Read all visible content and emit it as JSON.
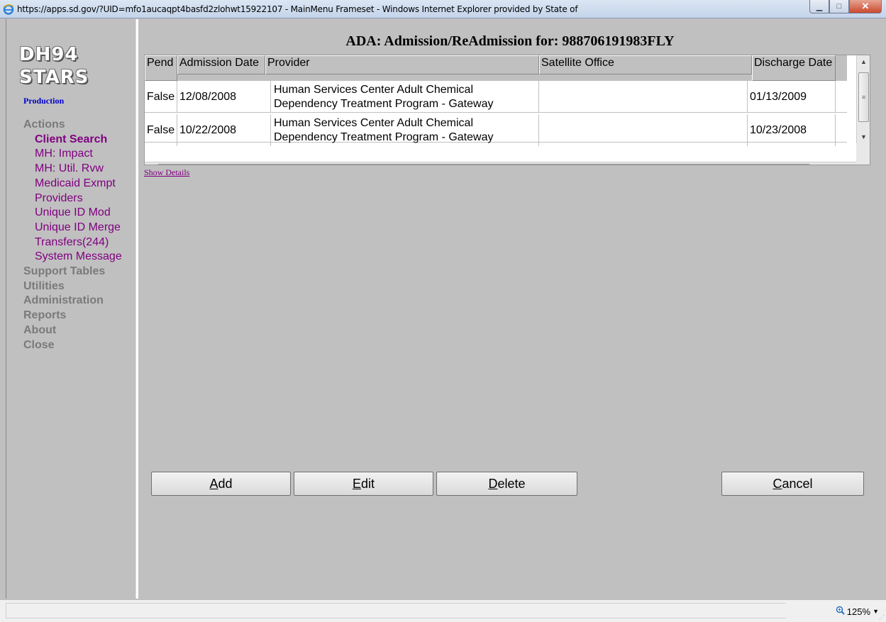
{
  "window": {
    "title": "https://apps.sd.gov/?UID=mfo1aucaqpt4basfd2zlohwt15922107 - MainMenu Frameset - Windows Internet Explorer provided by State of",
    "minimize_glyph": "▁",
    "maximize_glyph": "□",
    "close_glyph": "✕"
  },
  "sidebar": {
    "logo_line1": "DH94",
    "logo_line2": "STARS",
    "environment": "Production",
    "menu": [
      {
        "label": "Actions",
        "type": "group"
      },
      {
        "label": "Client Search",
        "type": "item",
        "active": true
      },
      {
        "label": "MH: Impact",
        "type": "item"
      },
      {
        "label": "MH: Util. Rvw",
        "type": "item"
      },
      {
        "label": "Medicaid Exmpt",
        "type": "item"
      },
      {
        "label": "Providers",
        "type": "item"
      },
      {
        "label": "Unique ID Mod",
        "type": "item"
      },
      {
        "label": "Unique ID Merge",
        "type": "item"
      },
      {
        "label": "Transfers(244)",
        "type": "item"
      },
      {
        "label": "System Message",
        "type": "item"
      },
      {
        "label": "Support Tables",
        "type": "group"
      },
      {
        "label": "Utilities",
        "type": "group"
      },
      {
        "label": "Administration",
        "type": "group"
      },
      {
        "label": "Reports",
        "type": "group"
      },
      {
        "label": "About",
        "type": "group"
      },
      {
        "label": "Close",
        "type": "group"
      }
    ]
  },
  "main": {
    "title": "ADA: Admission/ReAdmission for: 988706191983FLY",
    "grid": {
      "columns": [
        "Pend",
        "Admission Date",
        "Provider",
        "Satellite Office",
        "Discharge Date"
      ],
      "rows": [
        {
          "pend": "False",
          "admission_date": "12/08/2008",
          "provider": "Human Services Center Adult Chemical Dependency Treatment Program - Gateway",
          "satellite_office": "",
          "discharge_date": "01/13/2009"
        },
        {
          "pend": "False",
          "admission_date": "10/22/2008",
          "provider": "Human Services Center Adult Chemical Dependency Treatment Program - Gateway",
          "satellite_office": "",
          "discharge_date": "10/23/2008"
        }
      ]
    },
    "show_details": "Show Details",
    "buttons": {
      "add": {
        "access_key": "A",
        "rest": "dd"
      },
      "edit": {
        "access_key": "E",
        "rest": "dit"
      },
      "delete": {
        "access_key": "D",
        "rest": "elete"
      },
      "cancel": {
        "access_key": "C",
        "rest": "ancel"
      }
    }
  },
  "statusbar": {
    "zoom": "125%",
    "zoom_caret": "▼"
  }
}
